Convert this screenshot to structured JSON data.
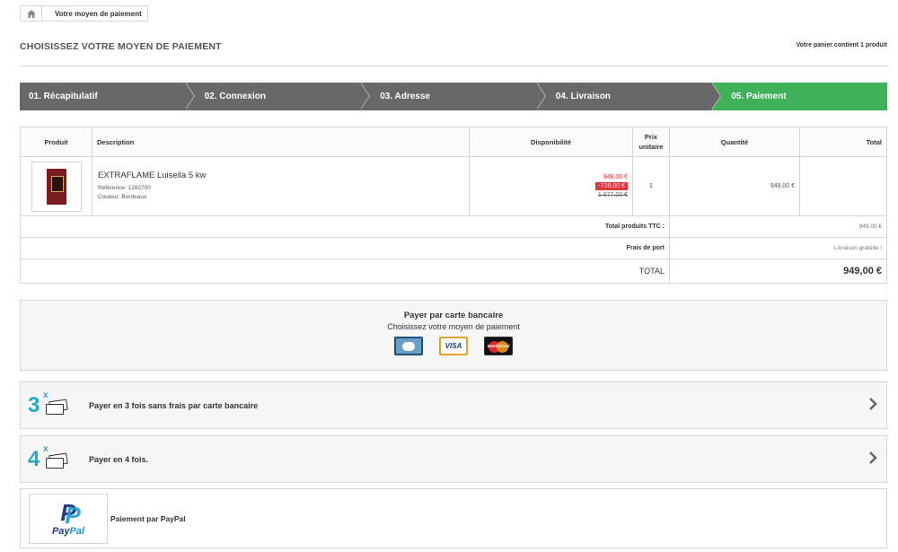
{
  "breadcrumb": {
    "current": "Votre moyen de paiement"
  },
  "header": {
    "title": "CHOISISSEZ VOTRE MOYEN DE PAIEMENT",
    "cart_count": "Votre panier contient 1 produit"
  },
  "steps": [
    {
      "label": "01. Récapitulatif",
      "active": false
    },
    {
      "label": "02. Connexion",
      "active": false
    },
    {
      "label": "03. Adresse",
      "active": false
    },
    {
      "label": "04. Livraison",
      "active": false
    },
    {
      "label": "05. Paiement",
      "active": true
    }
  ],
  "table": {
    "headers": {
      "product": "Produit",
      "description": "Description",
      "availability": "Disponibilité",
      "unit_price": "Prix unitaire",
      "quantity": "Quantité",
      "total": "Total"
    },
    "item": {
      "name": "EXTRAFLAME Luisella 5 kw",
      "reference": "Référence: 1282700",
      "color": "Couleur: Bordeaux",
      "price_new": "949,00 €",
      "discount": "-728,00 €",
      "price_old": "1 677,00 €",
      "unit": "1",
      "quantity_total": "949,00 €"
    },
    "summary": {
      "products_label": "Total produits TTC :",
      "products_value": "949,00 €",
      "shipping_label": "Frais de port",
      "shipping_value": "Livraison gratuite !",
      "total_label": "TOTAL",
      "total_value": "949,00 €"
    }
  },
  "payment": {
    "card": {
      "title": "Payer par carte bancaire",
      "subtitle": "Choisissez votre moyen de paiement",
      "logos": [
        "cb-logo",
        "visa-logo",
        "mastercard-logo"
      ],
      "visa_text": "VISA",
      "mastercard_text": "MasterCard"
    },
    "option3": {
      "num": "3",
      "x": "x",
      "label": "Payer en 3 fois sans frais par carte bancaire"
    },
    "option4": {
      "num": "4",
      "x": "x",
      "label": "Payer en 4 fois."
    },
    "paypal": {
      "label": "Paiement par PayPal",
      "logo_text_pay": "Pay",
      "logo_text_pal": "Pal"
    }
  },
  "colors": {
    "step_inactive": "#686868",
    "step_active": "#3fb15a",
    "discount": "#e3333b",
    "installment_icon": "#22a9c8"
  }
}
